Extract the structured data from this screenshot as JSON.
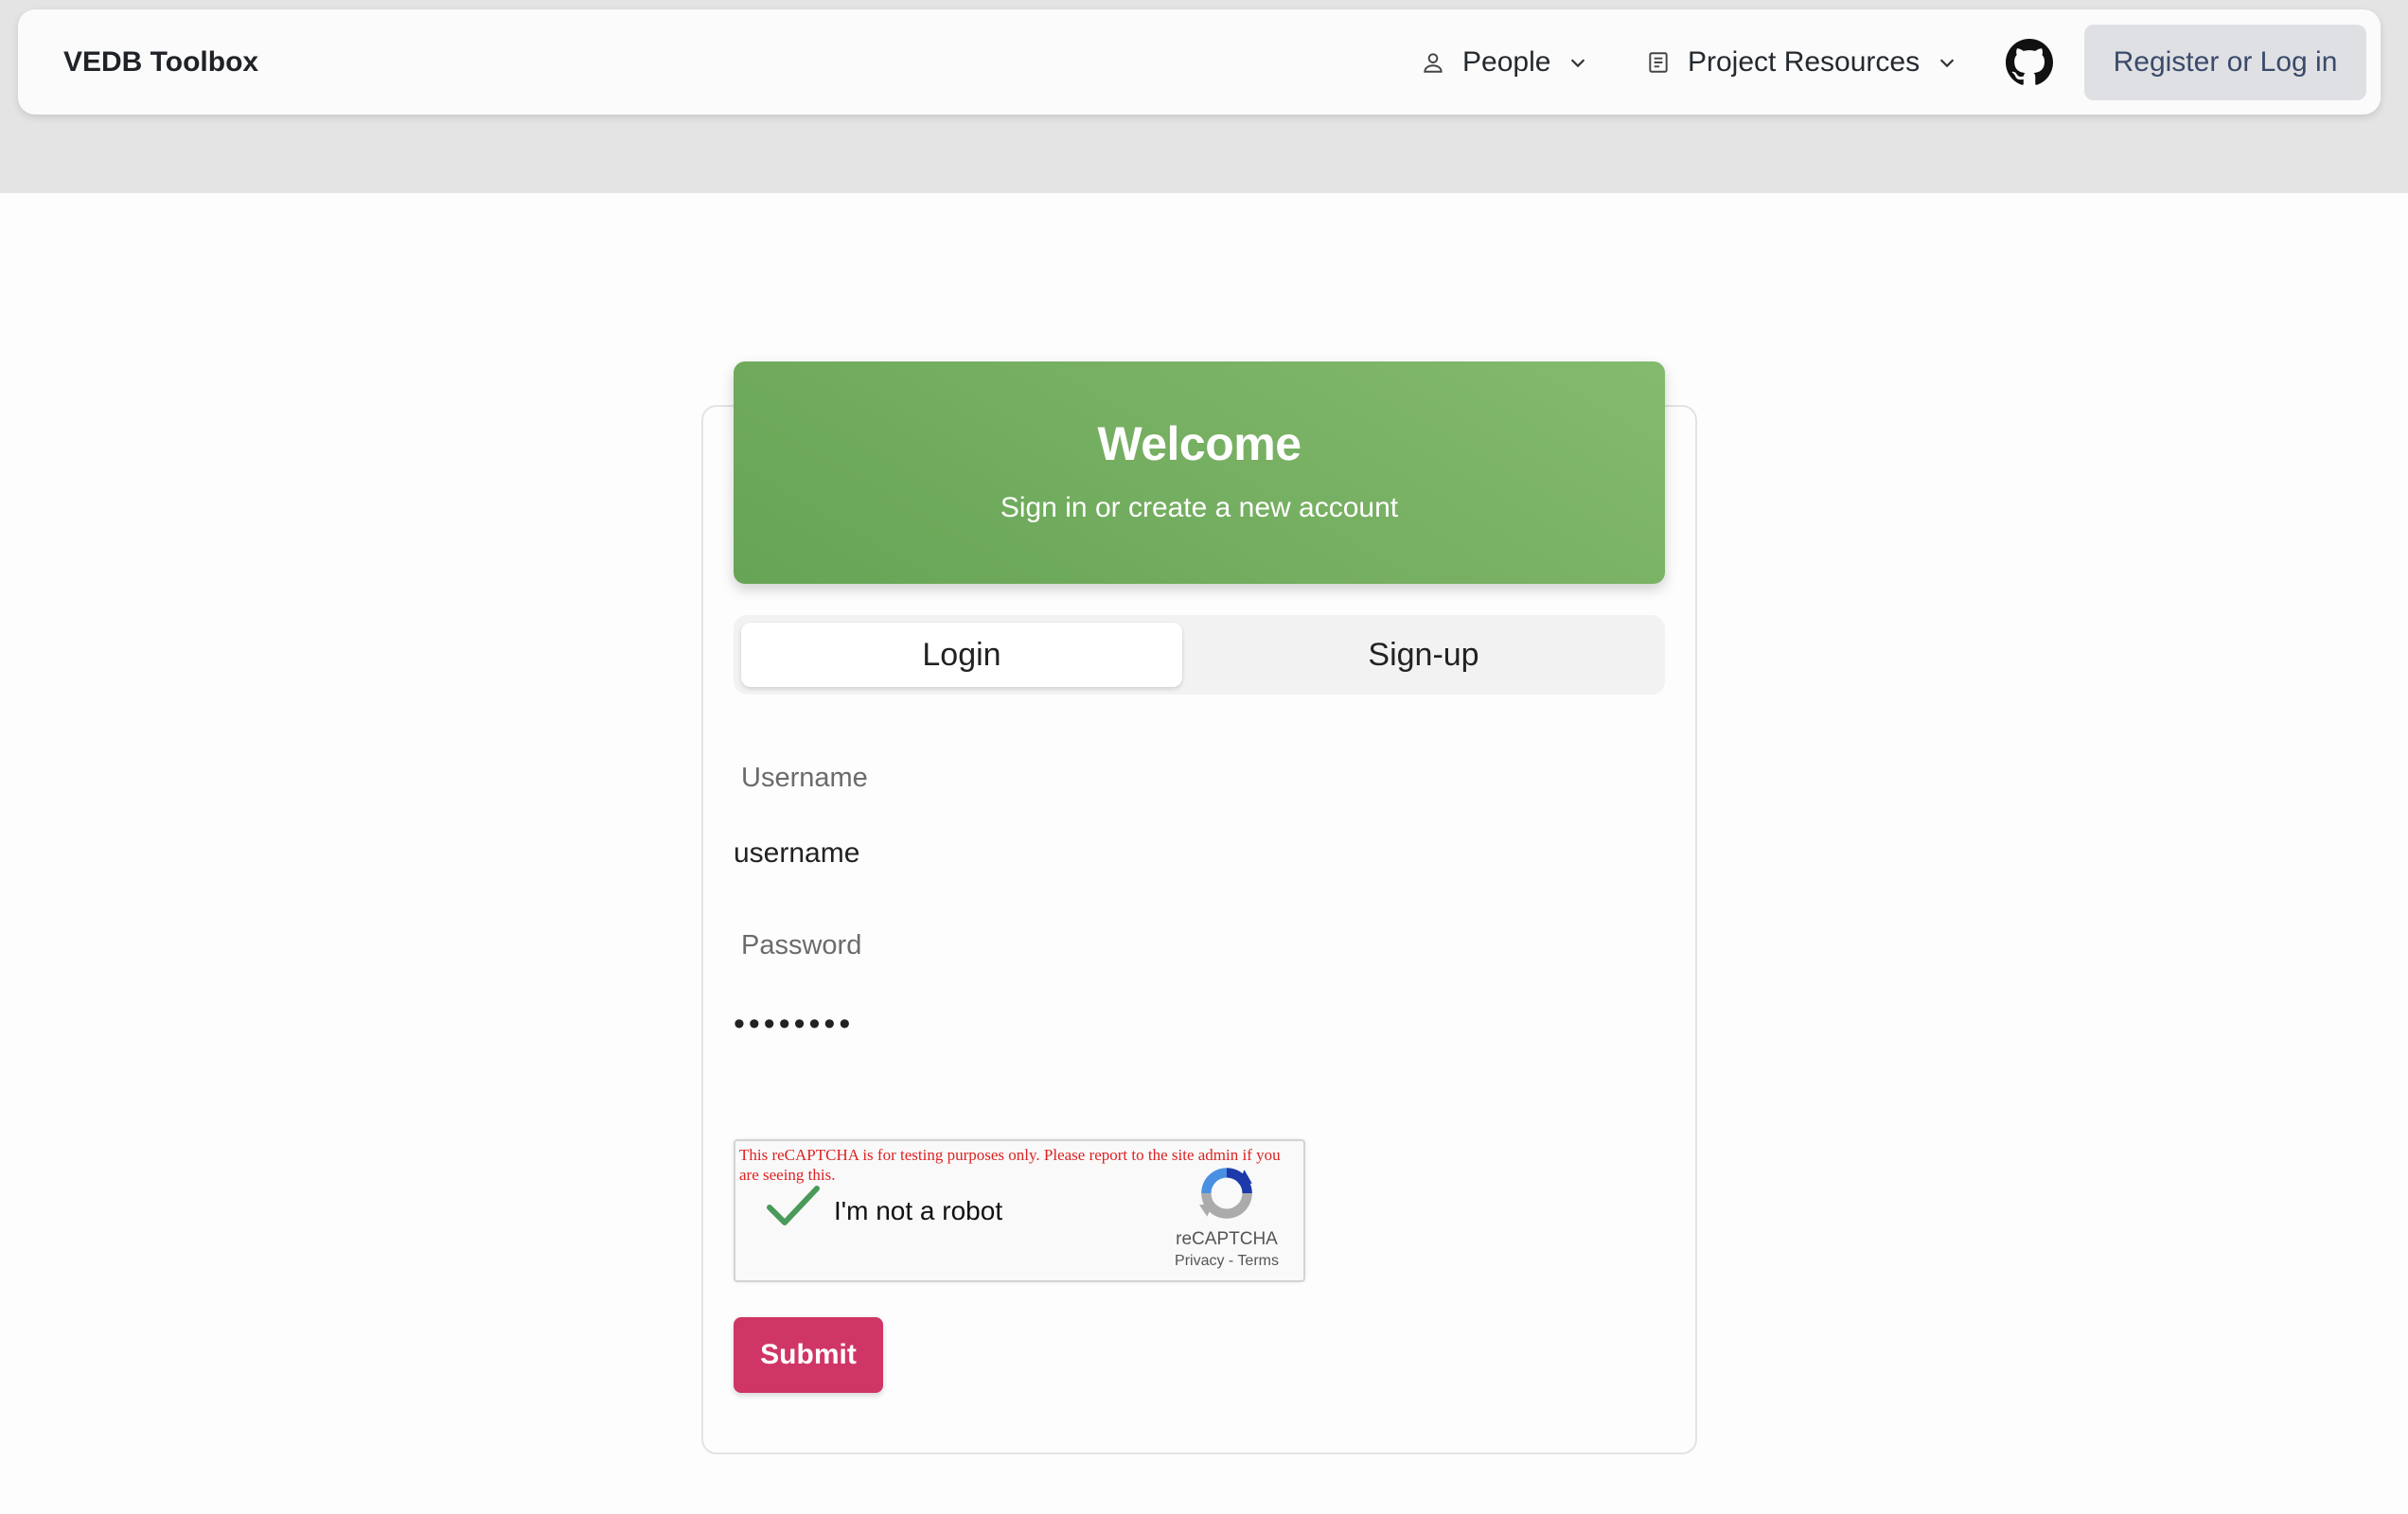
{
  "navbar": {
    "brand": "VEDB Toolbox",
    "people_label": "People",
    "resources_label": "Project Resources",
    "register_label": "Register or Log in"
  },
  "welcome": {
    "title": "Welcome",
    "subtitle": "Sign in or create a new account"
  },
  "tabs": {
    "login": "Login",
    "signup": "Sign-up",
    "active": "Login"
  },
  "form": {
    "username_label": "Username",
    "username_value": "username",
    "password_label": "Password",
    "password_value": "••••••••"
  },
  "recaptcha": {
    "warning": "This reCAPTCHA is for testing purposes only. Please report to the site admin if you are seeing this.",
    "checkbox_label": "I'm not a robot",
    "brand": "reCAPTCHA",
    "links": "Privacy - Terms",
    "checked": true
  },
  "submit_label": "Submit",
  "colors": {
    "welcome_gradient_start": "#67a455",
    "welcome_gradient_end": "#84ba6e",
    "submit": "#cf3665",
    "register_bg": "#dfe0e3",
    "register_text": "#3b4a6b",
    "check": "#4a9a5a"
  },
  "icons": {
    "people": "person-icon",
    "resources": "document-icon",
    "dropdown": "chevron-down-icon",
    "github": "github-icon",
    "recaptcha": "recaptcha-logo-icon",
    "check": "checkmark-icon"
  }
}
